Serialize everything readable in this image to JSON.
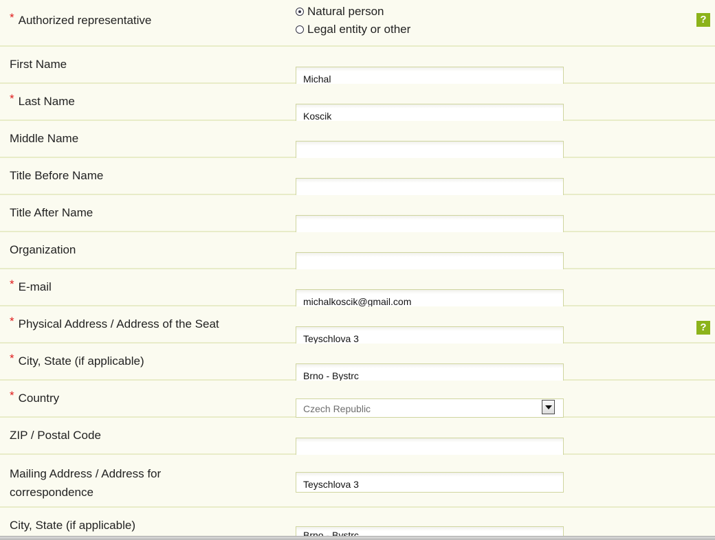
{
  "form": {
    "authorized_rep": {
      "label": "Authorized representative",
      "required": "*",
      "options": [
        "Natural person",
        "Legal entity or other"
      ],
      "selected": "Natural person",
      "help": "?"
    },
    "first_name": {
      "label": "First Name",
      "value": "Michal"
    },
    "last_name": {
      "label": "Last Name",
      "required": "*",
      "value": "Koscik"
    },
    "middle_name": {
      "label": "Middle Name",
      "value": ""
    },
    "title_before": {
      "label": "Title Before Name",
      "value": ""
    },
    "title_after": {
      "label": "Title After Name",
      "value": ""
    },
    "organization": {
      "label": "Organization",
      "value": ""
    },
    "email": {
      "label": "E-mail",
      "required": "*",
      "value": "michalkoscik@gmail.com"
    },
    "physical_address": {
      "label": "Physical Address / Address of the Seat",
      "required": "*",
      "value": "Teyschlova 3",
      "help": "?"
    },
    "city": {
      "label": "City, State (if applicable)",
      "required": "*",
      "value": "Brno - Bystrc"
    },
    "country": {
      "label": "Country",
      "required": "*",
      "value": "Czech Republic"
    },
    "zip": {
      "label": "ZIP / Postal Code",
      "value": ""
    },
    "mailing_address": {
      "label_line1": "Mailing Address / Address for",
      "label_line2": "correspondence",
      "value": "Teyschlova 3"
    },
    "mailing_city": {
      "label": "City, State (if applicable)",
      "value": "Brno - Bystrc"
    }
  },
  "colors": {
    "background": "#fbfbf0",
    "row_border": "#e8ecc8",
    "required_star": "#e01b1b",
    "help_badge": "#8cb31a",
    "field_border": "#cfd59f"
  },
  "icons": [
    "radio-checked-icon",
    "radio-unchecked-icon",
    "help-icon",
    "dropdown-arrow-icon"
  ]
}
